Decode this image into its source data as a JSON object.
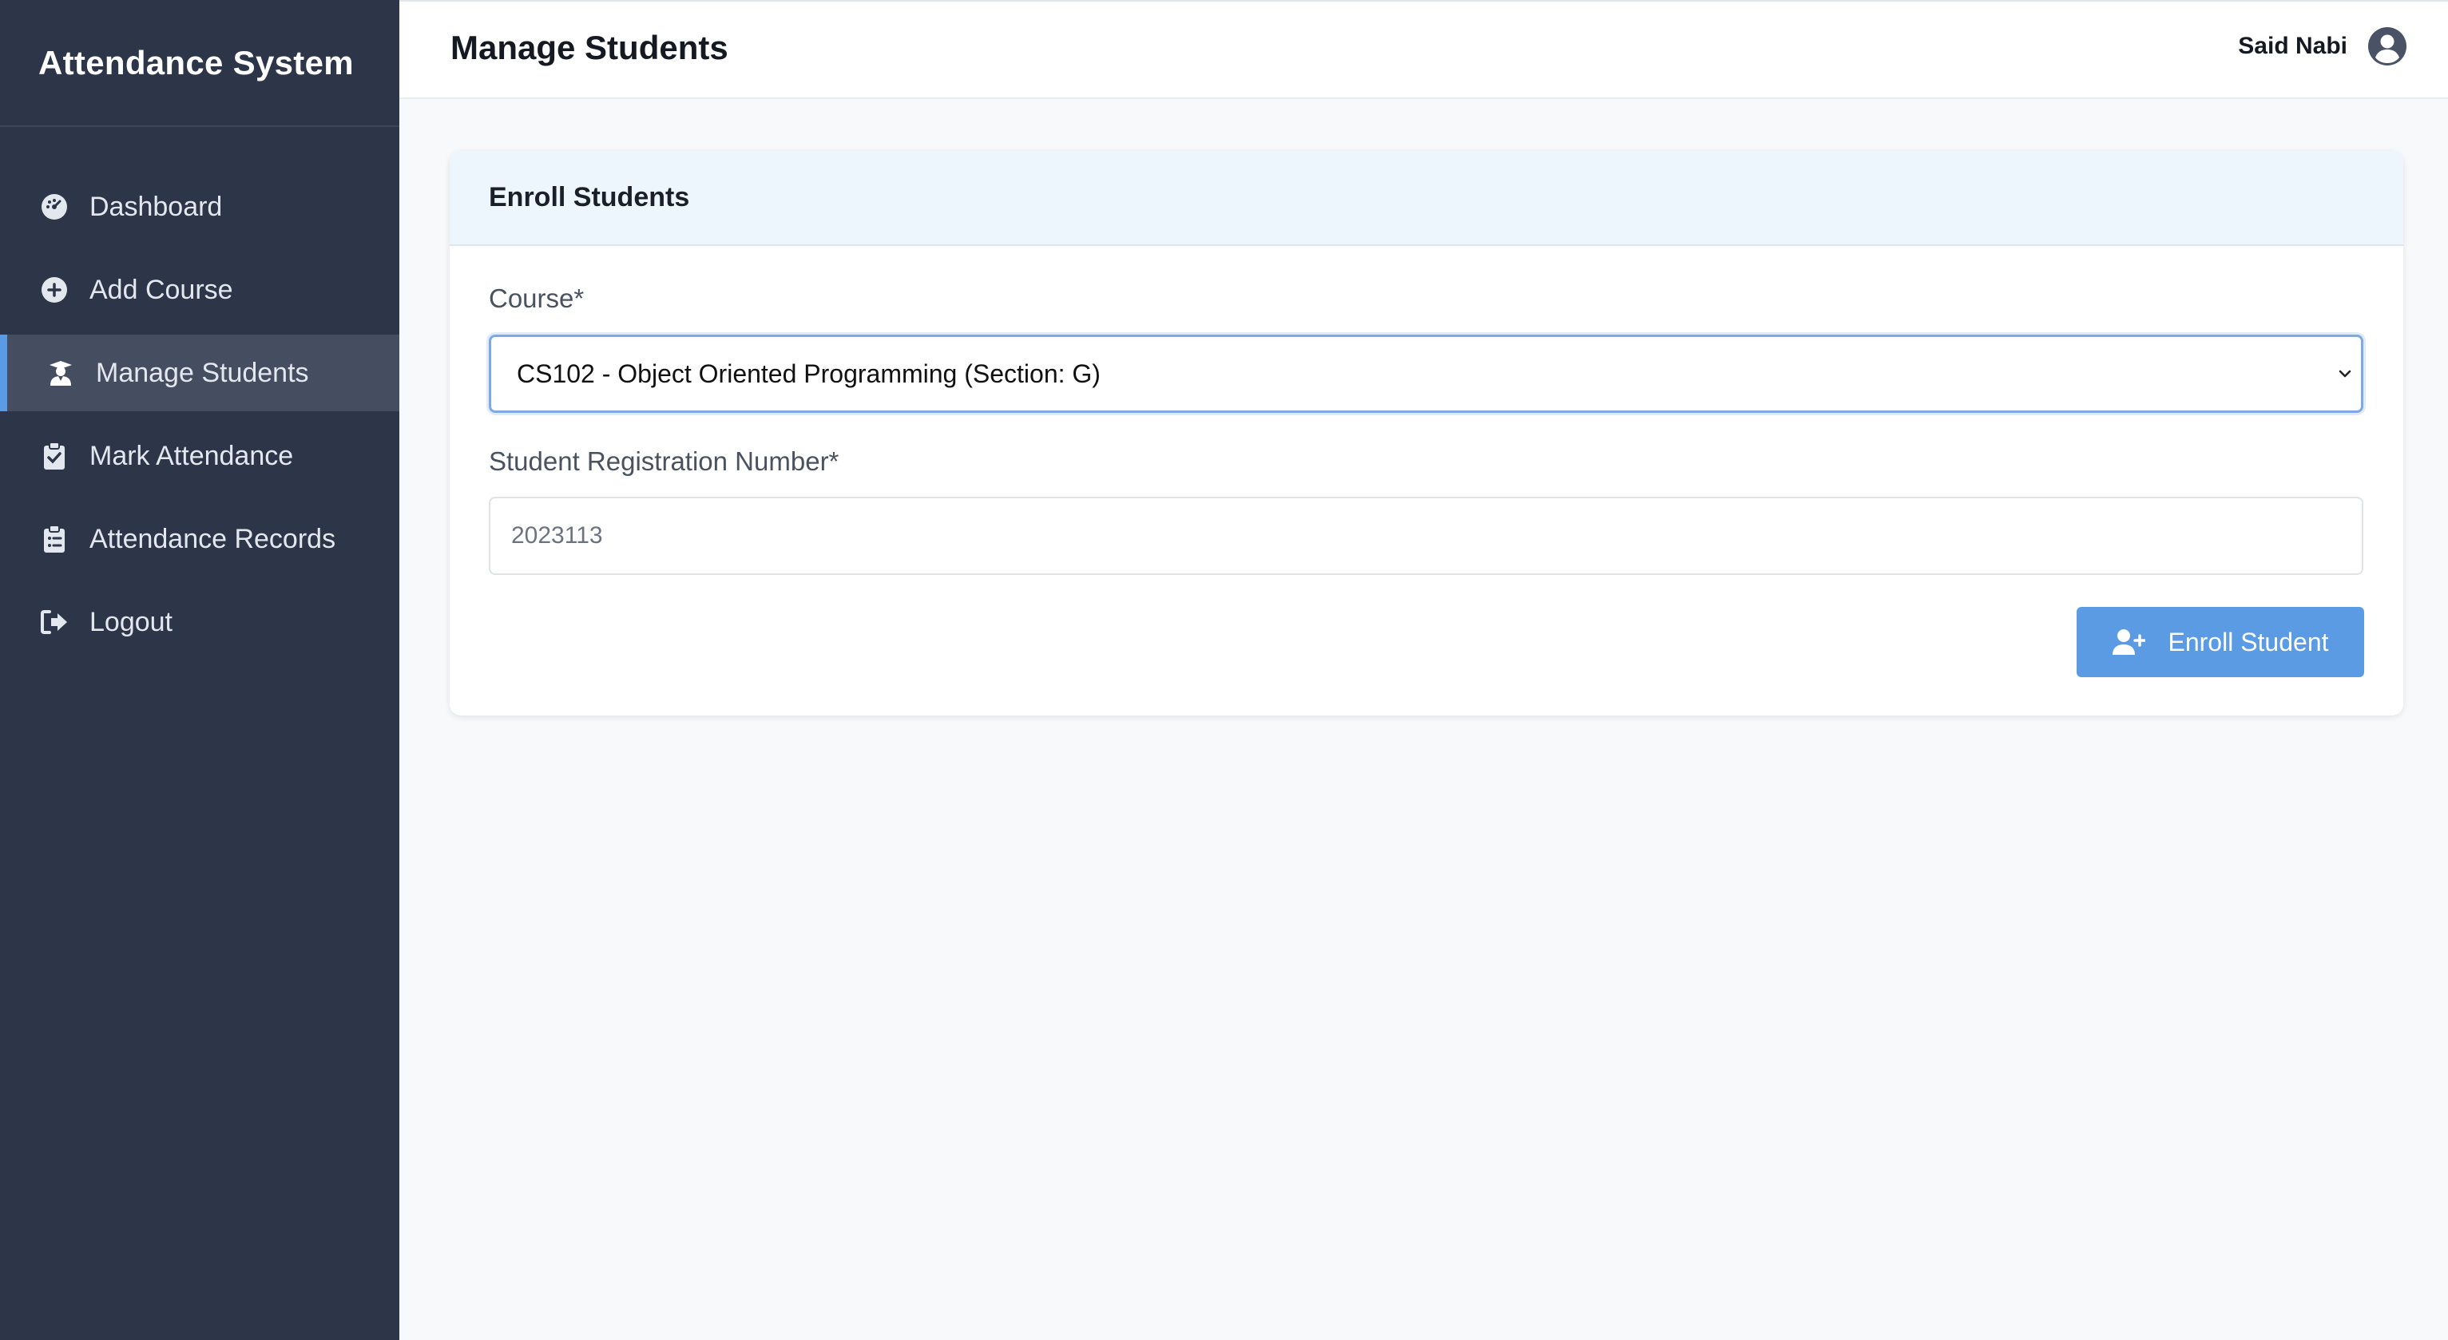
{
  "app": {
    "title": "Attendance System"
  },
  "sidebar": {
    "items": [
      {
        "label": "Dashboard",
        "icon": "dashboard-gauge-icon"
      },
      {
        "label": "Add Course",
        "icon": "plus-circle-icon"
      },
      {
        "label": "Manage Students",
        "icon": "student-icon",
        "active": true
      },
      {
        "label": "Mark Attendance",
        "icon": "clipboard-check-icon"
      },
      {
        "label": "Attendance Records",
        "icon": "clipboard-list-icon"
      },
      {
        "label": "Logout",
        "icon": "logout-icon"
      }
    ]
  },
  "header": {
    "title": "Manage Students",
    "user_name": "Said Nabi",
    "user_icon": "user-circle-icon"
  },
  "card": {
    "title": "Enroll Students",
    "course_label": "Course*",
    "course_selected": "CS102 - Object Oriented Programming (Section: G)",
    "reg_label": "Student Registration Number*",
    "reg_value": "2023113",
    "submit_label": "Enroll Student",
    "submit_icon": "user-plus-icon"
  },
  "colors": {
    "sidebar_bg": "#2d3548",
    "accent": "#5a9be4",
    "card_header_bg": "#edf6fd"
  }
}
